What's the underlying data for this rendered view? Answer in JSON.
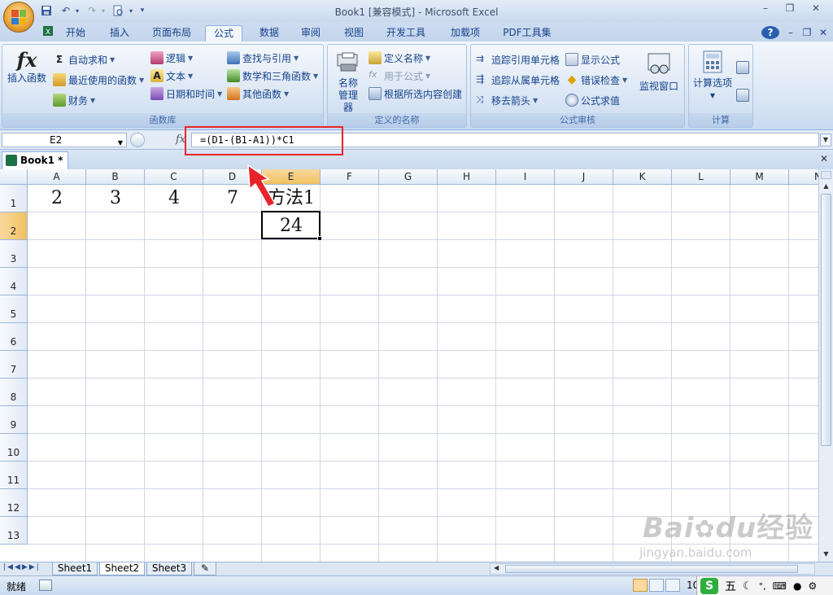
{
  "window": {
    "title": "Book1  [兼容模式] - Microsoft Excel",
    "minimize": "–",
    "restore": "❐",
    "close": "✕"
  },
  "doc_ctl": {
    "help": "?",
    "minimize": "–",
    "restore": "❐",
    "close": "✕"
  },
  "tabs": [
    "开始",
    "插入",
    "页面布局",
    "公式",
    "数据",
    "审阅",
    "视图",
    "开发工具",
    "加载项",
    "PDF工具集"
  ],
  "ribbon": {
    "function_library": {
      "label": "函数库",
      "insert_function": "插入函数",
      "autosum": "自动求和",
      "recent": "最近使用的函数",
      "financial": "财务",
      "logical": "逻辑",
      "text": "文本",
      "datetime": "日期和时间",
      "lookup": "查找与引用",
      "math": "数学和三角函数",
      "other": "其他函数"
    },
    "defined_names": {
      "label": "定义的名称",
      "name_manager": "名称管理器",
      "define_name": "定义名称",
      "use_in_formula": "用于公式",
      "create_from_selection": "根据所选内容创建"
    },
    "formula_auditing": {
      "label": "公式审核",
      "trace_precedents": "追踪引用单元格",
      "trace_dependents": "追踪从属单元格",
      "remove_arrows": "移去箭头",
      "show_formulas": "显示公式",
      "error_checking": "错误检查",
      "evaluate": "公式求值",
      "watch_window": "监视窗口"
    },
    "calculation": {
      "label": "计算",
      "options": "计算选项"
    }
  },
  "formula_bar": {
    "name_box": "E2",
    "fx": "fx",
    "formula": "=(D1-(B1-A1))*C1"
  },
  "workbook_tab": {
    "name": "Book1 *",
    "close": "✕"
  },
  "columns": [
    "A",
    "B",
    "C",
    "D",
    "E",
    "F",
    "G",
    "H",
    "I",
    "J",
    "K",
    "L",
    "M",
    "N"
  ],
  "rows": [
    "1",
    "2",
    "3",
    "4",
    "5",
    "6",
    "7",
    "8",
    "9",
    "10",
    "11",
    "12",
    "13"
  ],
  "cells": {
    "A1": "2",
    "B1": "3",
    "C1": "4",
    "D1": "7",
    "E1": "方法1",
    "E2": "24"
  },
  "sheets": [
    "Sheet1",
    "Sheet2",
    "Sheet3"
  ],
  "active_sheet": "Sheet2",
  "status": {
    "mode": "就绪",
    "zoom": "10"
  },
  "ime": {
    "five": "五"
  },
  "watermark": {
    "brand": "Bai",
    "du": "du",
    "jingyan": "经验",
    "url": "jingyan.baidu.com"
  }
}
